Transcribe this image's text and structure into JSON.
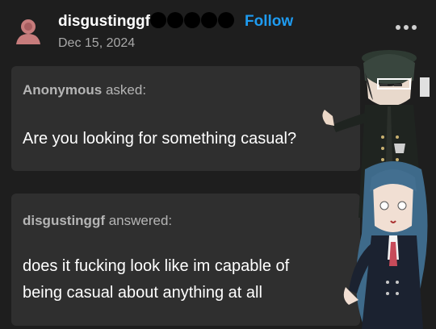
{
  "post": {
    "username": "disgustinggf",
    "follow_label": "Follow",
    "date": "Dec 15, 2024"
  },
  "question": {
    "asker": "Anonymous",
    "verb": "asked:",
    "text": "Are you looking for something casual?"
  },
  "answer": {
    "answerer": "disgustinggf",
    "verb": "answered:",
    "line1": "does it fucking look like im capable of",
    "line2": "being casual about anything at all"
  },
  "colors": {
    "background": "#1e1e1e",
    "card": "#2f2f2f",
    "follow": "#1e9bf0"
  },
  "icons": {
    "avatar": "person-avatar-icon",
    "more": "more-options-icon"
  }
}
